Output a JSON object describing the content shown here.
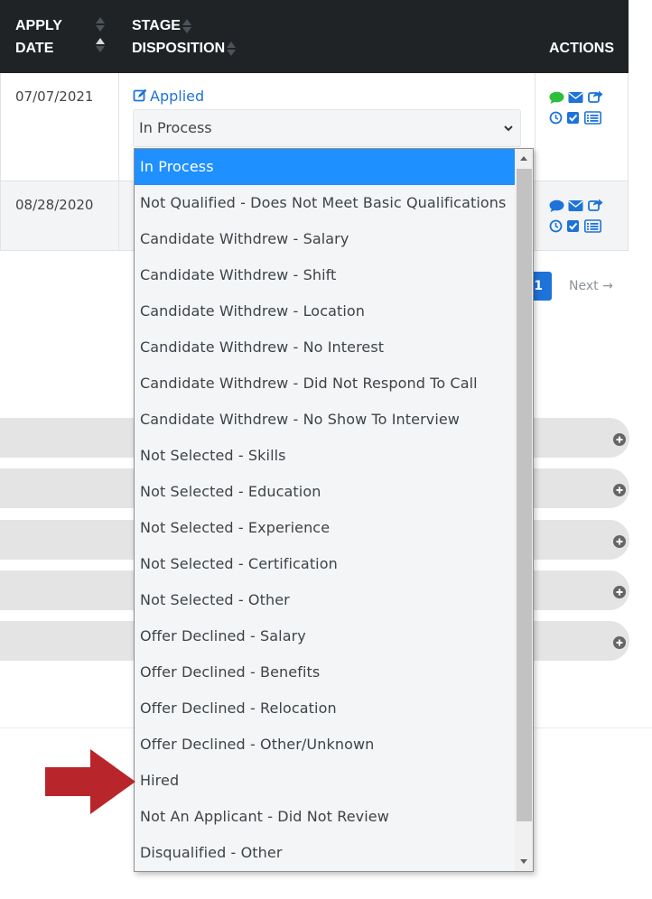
{
  "table": {
    "headers": {
      "apply_line1": "APPLY",
      "apply_line2": "DATE",
      "stage_line1": "STAGE",
      "stage_line2": "DISPOSITION",
      "actions": "ACTIONS"
    },
    "rows": [
      {
        "apply_date": "07/07/2021",
        "stage": "Applied",
        "disposition": "In Process"
      },
      {
        "apply_date": "08/28/2020"
      }
    ]
  },
  "pagination": {
    "current_page": "1",
    "next_label": "Next →"
  },
  "dropdown": {
    "selected": "In Process",
    "options": [
      "In Process",
      "Not Qualified - Does Not Meet Basic Qualifications",
      "Candidate Withdrew - Salary",
      "Candidate Withdrew - Shift",
      "Candidate Withdrew - Location",
      "Candidate Withdrew - No Interest",
      "Candidate Withdrew - Did Not Respond To Call",
      "Candidate Withdrew - No Show To Interview",
      "Not Selected - Skills",
      "Not Selected - Education",
      "Not Selected - Experience",
      "Not Selected - Certification",
      "Not Selected - Other",
      "Offer Declined - Salary",
      "Offer Declined - Benefits",
      "Offer Declined - Relocation",
      "Offer Declined - Other/Unknown",
      "Hired",
      "Not An Applicant - Did Not Review",
      "Disqualified - Other"
    ]
  },
  "colors": {
    "header_bg": "#1f2326",
    "link_blue": "#1e73d9",
    "selected_bg": "#1e90ff",
    "chat_green": "#2dbe3c",
    "arrow_red": "#b8262b"
  },
  "icons": [
    "edit-icon",
    "chat-icon",
    "mail-icon",
    "share-icon",
    "clock-icon",
    "check-icon",
    "list-icon",
    "plus-circle-icon",
    "chevron-down-icon",
    "red-arrow-icon"
  ]
}
